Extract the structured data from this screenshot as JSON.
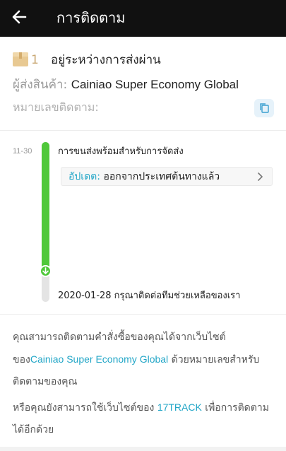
{
  "header": {
    "title": "การติดตาม",
    "back_icon": "arrow-left-icon"
  },
  "package": {
    "icon": "package-box-icon",
    "count": "1",
    "status": "อยู่ระหว่างการส่งผ่าน",
    "sender_label": "ผู้ส่งสินค้า:",
    "sender_value": "Cainiao Super Economy Global",
    "tracking_label": "หมายเลขติดตาม:",
    "copy_icon": "copy-icon"
  },
  "timeline": {
    "event_time": "11-30",
    "event_title": "การขนส่งพร้อมสำหรับการจัดส่ง",
    "update_label": "อัปเดต:",
    "update_value": "ออกจากประเทศต้นทางแล้ว",
    "last_event": "2020-01-28 กรุณาติดต่อทีมช่วยเหลือของเรา",
    "colors": {
      "progress": "#4fc83a",
      "link": "#22a6c7"
    }
  },
  "info": {
    "p1_a": "คุณสามารถติดตามคำสั่งซื้อของคุณได้จากเว็บไซต์ของ",
    "p1_link": "Cainiao Super Economy Global",
    "p1_b": " ด้วยหมายเลขสำหรับติดตามของคุณ",
    "p2_a": "หรือคุณยังสามารถใช้เว็บไซต์ของ ",
    "p2_link": "17TRACK",
    "p2_b": " เพื่อการติดตามได้อีกด้วย"
  }
}
